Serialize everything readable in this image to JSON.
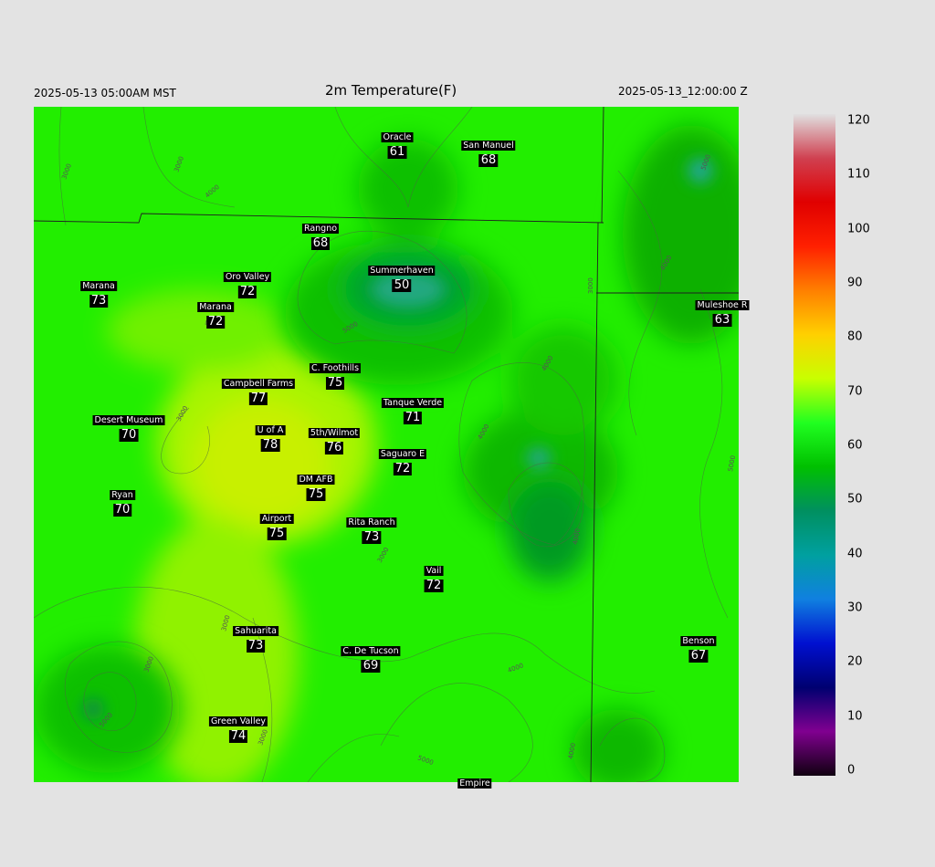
{
  "header": {
    "left": "2025-05-13 05:00AM MST",
    "title": "2m Temperature(F)",
    "right": "2025-05-13_12:00:00 Z"
  },
  "stations": [
    {
      "name": "Oracle",
      "value": "61"
    },
    {
      "name": "San Manuel",
      "value": "68"
    },
    {
      "name": "Rangno",
      "value": "68"
    },
    {
      "name": "Summerhaven",
      "value": "50"
    },
    {
      "name": "Marana",
      "value": "73"
    },
    {
      "name": "Oro Valley",
      "value": "72"
    },
    {
      "name": "Marana",
      "value": "72"
    },
    {
      "name": "Muleshoe R",
      "value": "63"
    },
    {
      "name": "C. Foothills",
      "value": "75"
    },
    {
      "name": "Campbell Farms",
      "value": "77"
    },
    {
      "name": "Tanque Verde",
      "value": "71"
    },
    {
      "name": "Desert Museum",
      "value": "70"
    },
    {
      "name": "U of A",
      "value": "78"
    },
    {
      "name": "5th/Wilmot",
      "value": "76"
    },
    {
      "name": "Saguaro E",
      "value": "72"
    },
    {
      "name": "DM AFB",
      "value": "75"
    },
    {
      "name": "Ryan",
      "value": "70"
    },
    {
      "name": "Airport",
      "value": "75"
    },
    {
      "name": "Rita Ranch",
      "value": "73"
    },
    {
      "name": "Vail",
      "value": "72"
    },
    {
      "name": "Sahuarita",
      "value": "73"
    },
    {
      "name": "C. De Tucson",
      "value": "69"
    },
    {
      "name": "Benson",
      "value": "67"
    },
    {
      "name": "Green Valley",
      "value": "74"
    },
    {
      "name": "Empire",
      "value": ""
    }
  ],
  "contour_labels": [
    "3000",
    "3000",
    "4000",
    "4000",
    "5000",
    "3000",
    "4000",
    "4000",
    "3000",
    "3000",
    "3000",
    "4000",
    "5000",
    "4000",
    "3000",
    "4000",
    "5000",
    "5000",
    "5000",
    "4000",
    "3000"
  ],
  "colorbar": {
    "ticks": [
      "120",
      "110",
      "100",
      "90",
      "80",
      "70",
      "60",
      "50",
      "40",
      "30",
      "20",
      "10",
      "0"
    ],
    "stops": [
      "#e0e0e0",
      "#d04050",
      "#e00000",
      "#ff2000",
      "#ff8000",
      "#ffd000",
      "#c8ff00",
      "#20ff20",
      "#00c000",
      "#009060",
      "#00a0a0",
      "#1080e0",
      "#0010d0",
      "#000070",
      "#800090",
      "#100010"
    ]
  },
  "colors": {
    "background": "#e3e3e3",
    "warm_field": "#c8f000",
    "mid_field": "#20ee00",
    "cool_field": "#00b000",
    "mountain": "#20a880"
  }
}
